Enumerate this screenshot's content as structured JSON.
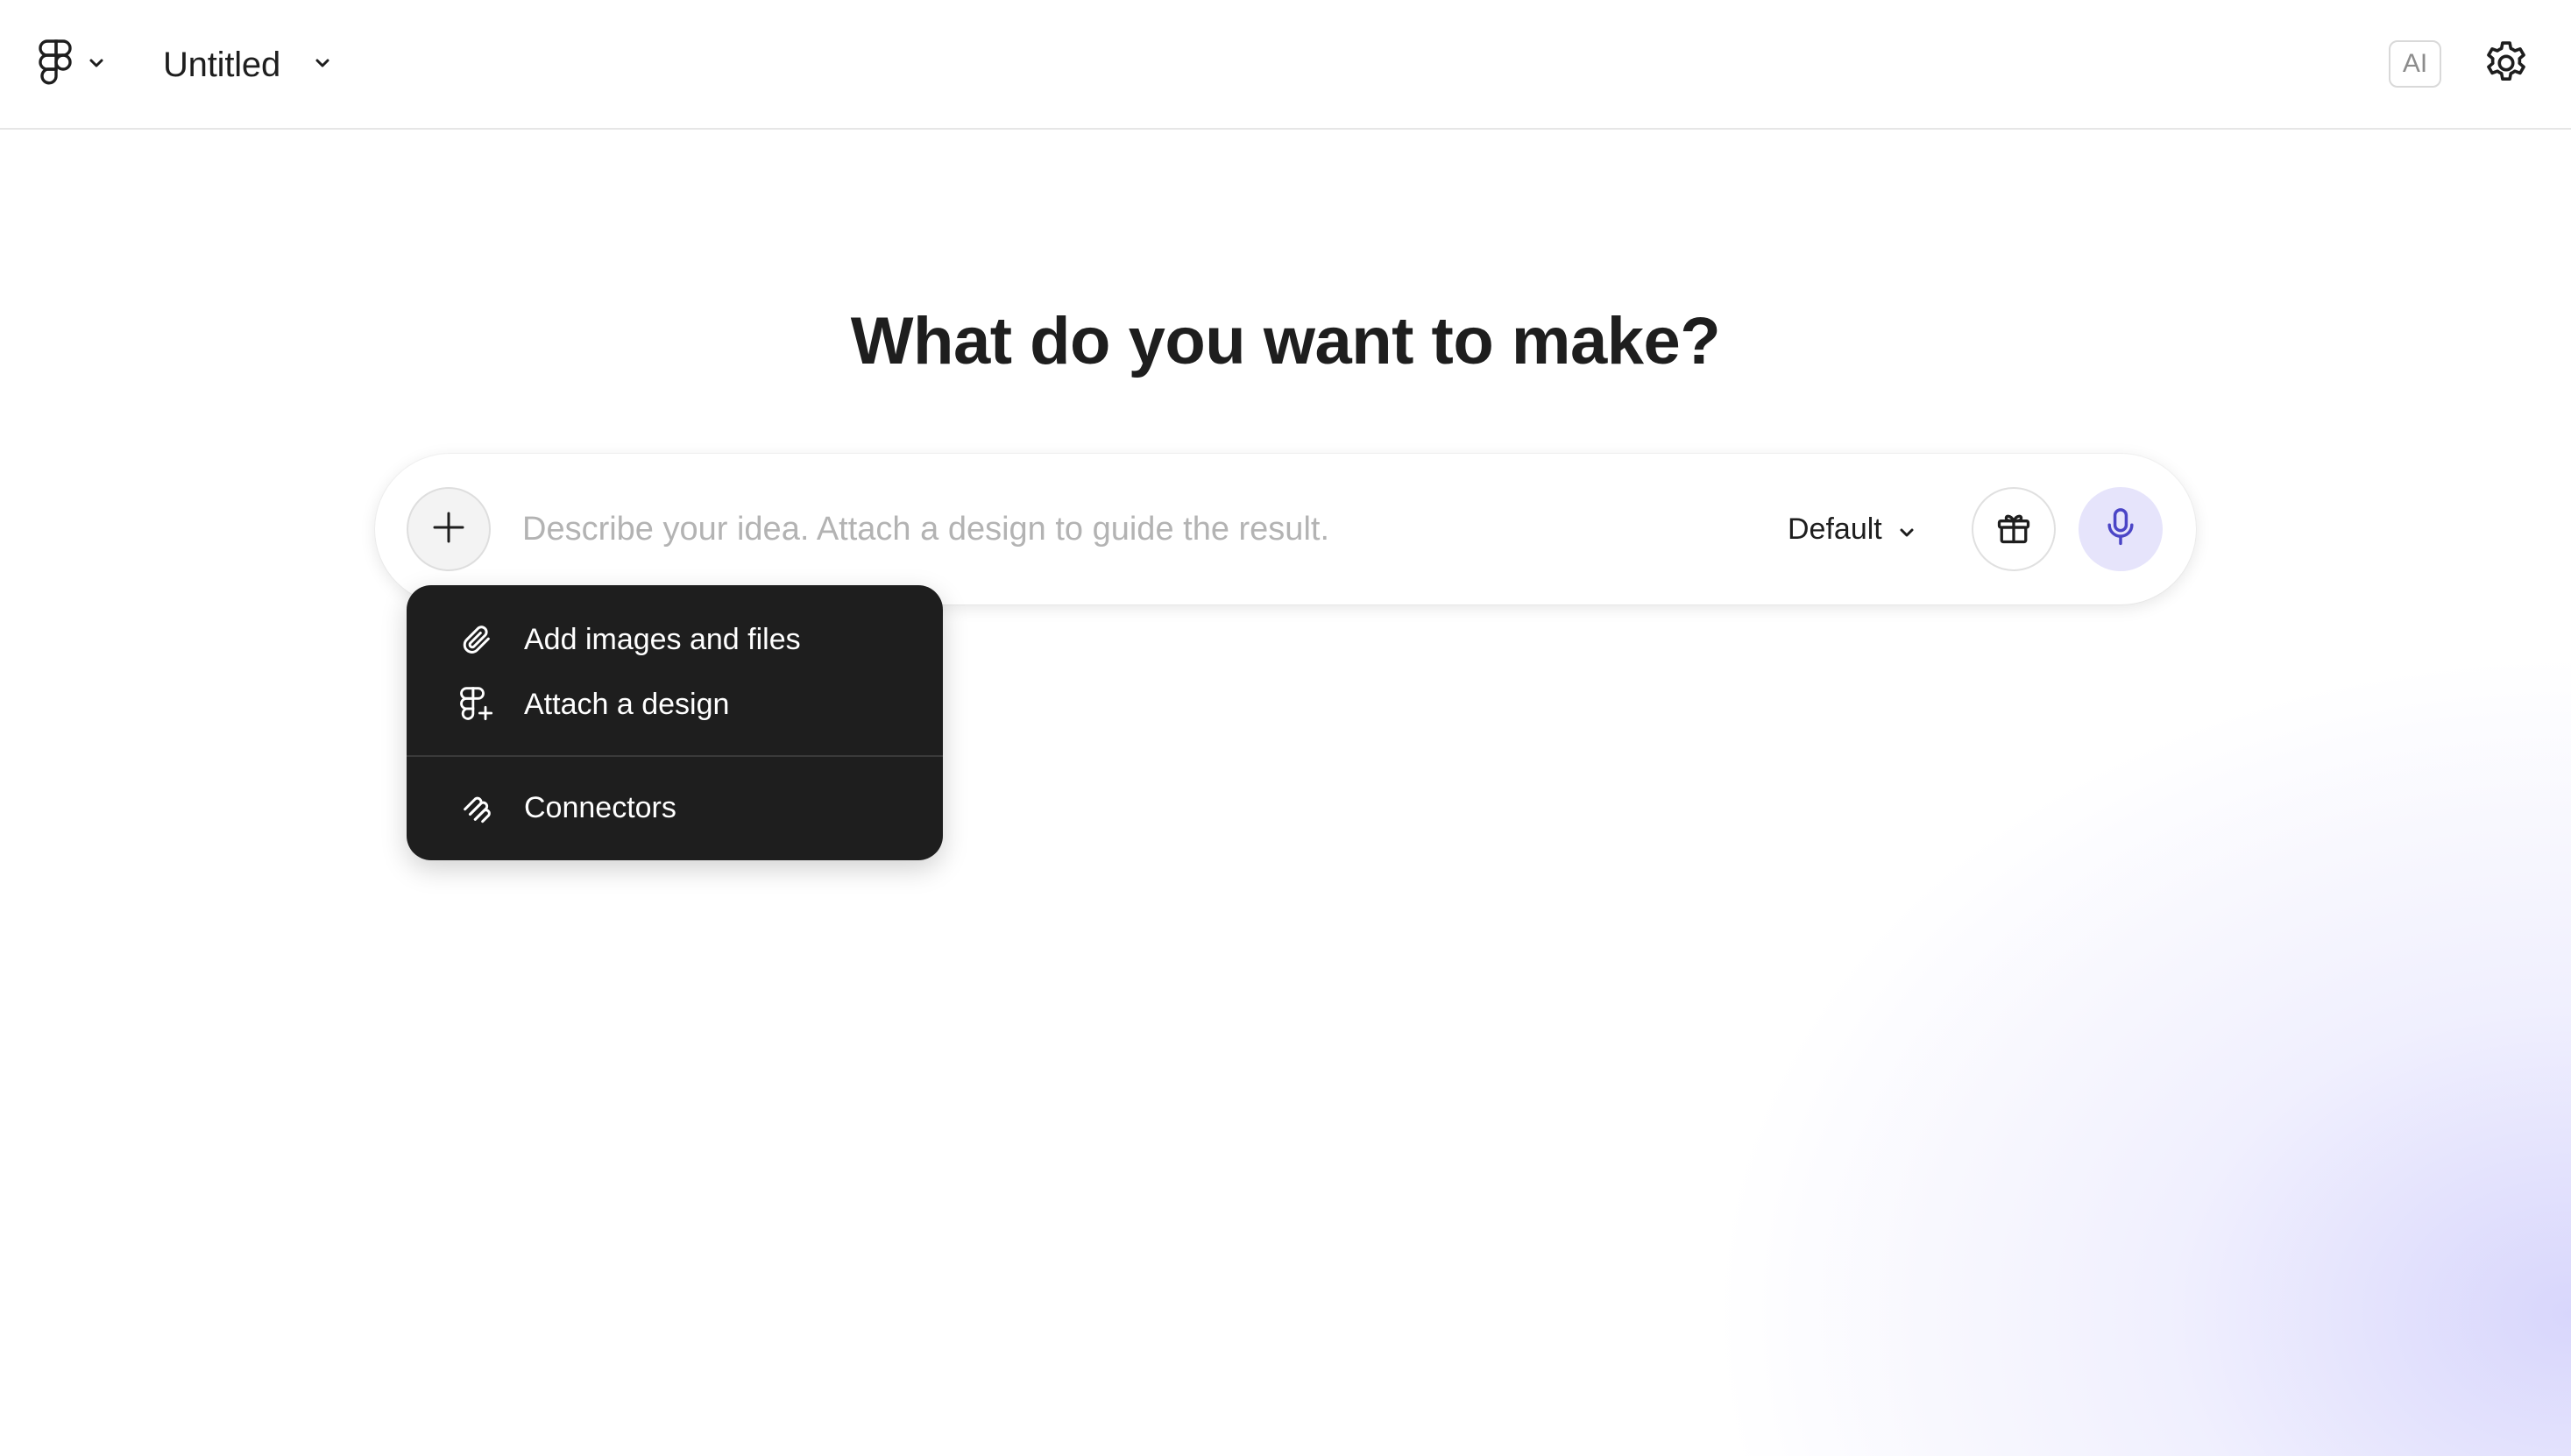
{
  "header": {
    "logo_icon": "figma-logo-icon",
    "file_title": "Untitled",
    "ai_badge": "AI",
    "settings_icon": "gear-icon"
  },
  "main": {
    "headline": "What do you want to make?"
  },
  "prompt": {
    "add_icon": "plus-icon",
    "placeholder": "Describe your idea. Attach a design to guide the result.",
    "value": "",
    "model_selected": "Default",
    "gift_icon": "gift-icon",
    "mic_icon": "microphone-icon"
  },
  "attach_menu": {
    "items": [
      {
        "label": "Add images and files",
        "icon": "paperclip-icon"
      },
      {
        "label": "Attach a design",
        "icon": "figma-add-icon"
      },
      {
        "label": "Connectors",
        "icon": "connectors-icon"
      }
    ]
  },
  "colors": {
    "menu_bg": "#1e1e1e",
    "mic_bg": "#e6e4fb",
    "accent": "#4b45c6"
  }
}
